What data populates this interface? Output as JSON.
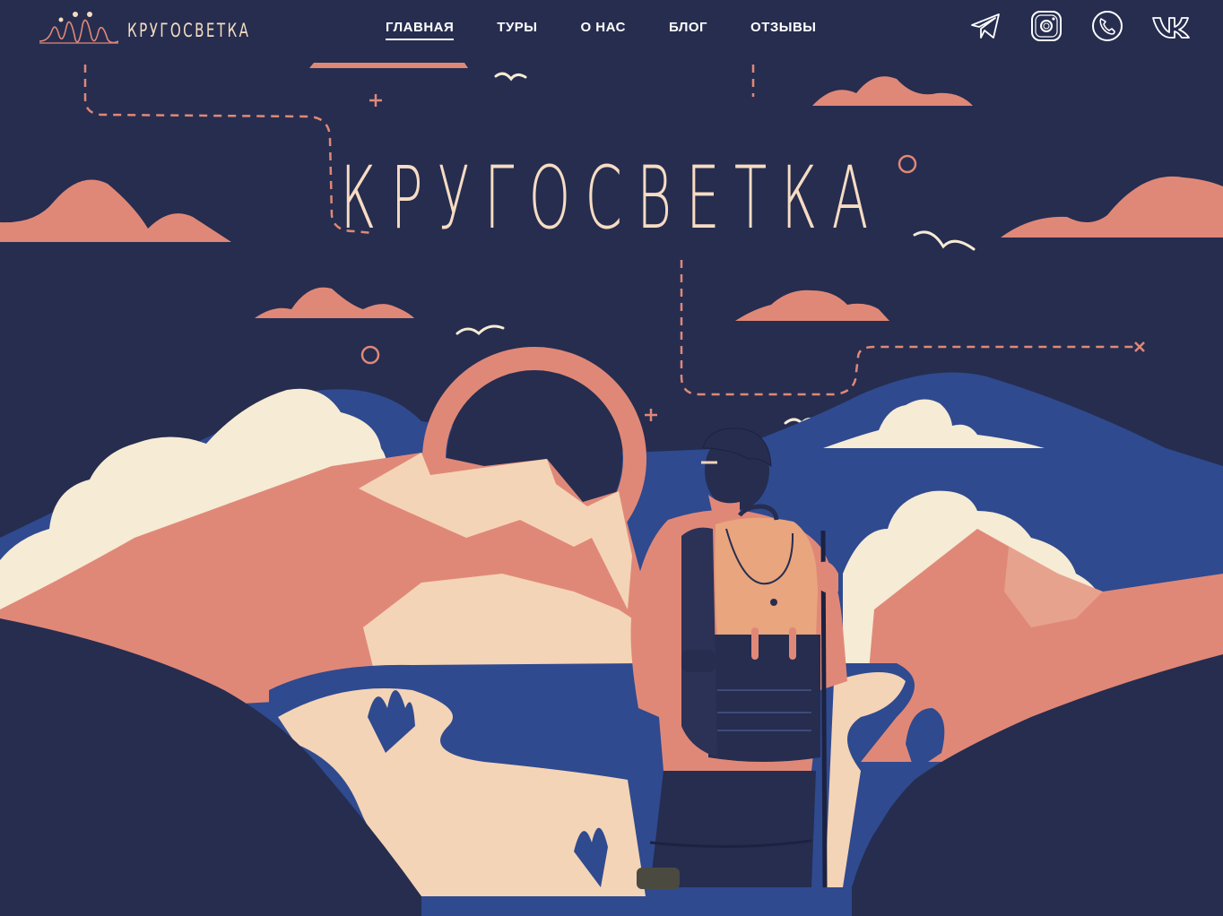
{
  "site": {
    "logo_text": "КРУГОСВЕТКА"
  },
  "nav": {
    "items": [
      {
        "label": "ГЛАВНАЯ",
        "active": true
      },
      {
        "label": "ТУРЫ"
      },
      {
        "label": "О НАС"
      },
      {
        "label": "БЛОГ"
      },
      {
        "label": "ОТЗЫВЫ"
      }
    ]
  },
  "social": [
    "telegram-icon",
    "instagram-icon",
    "phone-icon",
    "vk-icon"
  ],
  "hero": {
    "title": "КРУГОСВЕТКА"
  },
  "colors": {
    "background": "#262d4f",
    "salmon": "#e08878",
    "cream": "#f6ebd4",
    "sand": "#f4d4b6",
    "blue": "#2f4a8f",
    "title": "#f7dcc3"
  }
}
